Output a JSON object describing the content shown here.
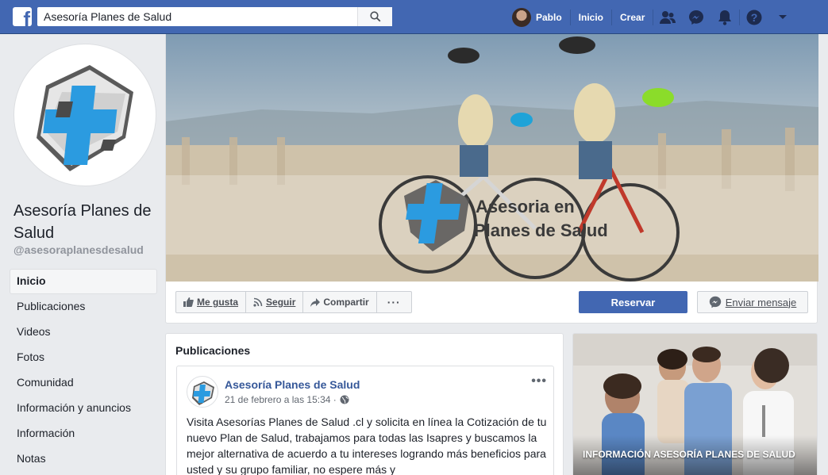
{
  "topbar": {
    "logo": "f",
    "search_value": "Asesoría Planes de Salud",
    "user_name": "Pablo",
    "home_label": "Inicio",
    "create_label": "Crear",
    "icons": [
      "friends-icon",
      "messenger-icon",
      "bell-icon",
      "help-icon",
      "chevron-down-icon"
    ]
  },
  "page": {
    "name": "Asesoría Planes de Salud",
    "handle": "@asesoraplanesdesalud",
    "cover_text_line1": "Asesoria en",
    "cover_text_line2": "Planes de Salud"
  },
  "nav": {
    "items": [
      {
        "label": "Inicio"
      },
      {
        "label": "Publicaciones"
      },
      {
        "label": "Videos"
      },
      {
        "label": "Fotos"
      },
      {
        "label": "Comunidad"
      },
      {
        "label": "Información y anuncios"
      },
      {
        "label": "Información"
      },
      {
        "label": "Notas"
      }
    ]
  },
  "actions": {
    "like": "Me gusta",
    "follow": "Seguir",
    "share": "Compartir",
    "more": "···",
    "reserve": "Reservar",
    "message": "Enviar mensaje"
  },
  "posts": {
    "title": "Publicaciones",
    "author": "Asesoría Planes de Salud",
    "date": "21 de febrero a las 15:34 ·",
    "more": "•••",
    "text": "Visita Asesorías Planes de Salud .cl y solicita en línea la Cotización de tu nuevo Plan de Salud, trabajamos para todas las Isapres y buscamos la mejor alternativa de acuerdo a tu intereses logrando más beneficios para usted y su grupo familiar, no espere más y"
  },
  "info_card": {
    "caption": "Información Asesoría Planes de Salud"
  },
  "colors": {
    "brand": "#4267b2",
    "logo_blue": "#2b9be0",
    "logo_gray": "#4a4a4a"
  }
}
